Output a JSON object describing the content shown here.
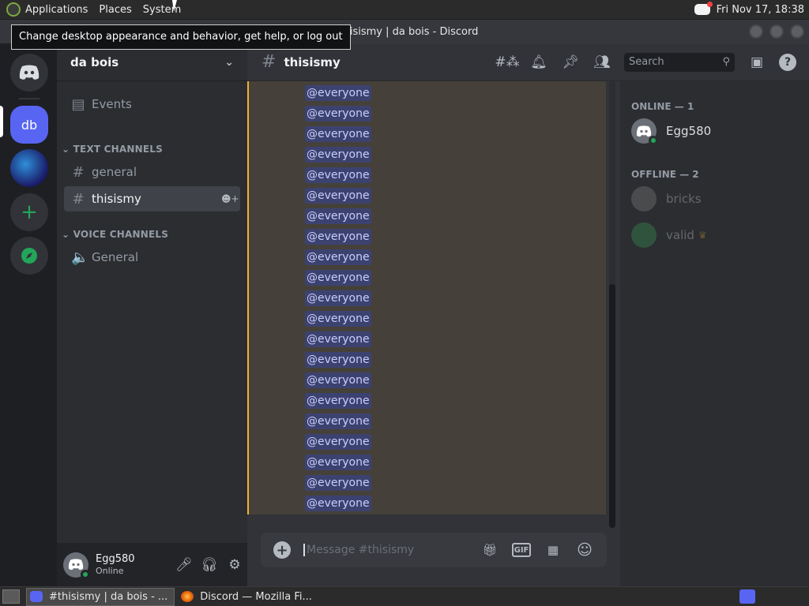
{
  "desktop": {
    "menus": [
      "Applications",
      "Places",
      "System"
    ],
    "clock": "Fri Nov 17, 18:38",
    "tooltip": "Change desktop appearance and behavior, get help, or log out"
  },
  "window": {
    "title": "#thisismy | da bois - Discord"
  },
  "guilds": {
    "db_label": "db"
  },
  "server": {
    "name": "da bois",
    "events_label": "Events",
    "text_category": "TEXT CHANNELS",
    "text_channels": [
      {
        "name": "general"
      },
      {
        "name": "thisismy"
      }
    ],
    "voice_category": "VOICE CHANNELS",
    "voice_channels": [
      {
        "name": "General"
      }
    ]
  },
  "user": {
    "name": "Egg580",
    "status": "Online"
  },
  "channel": {
    "name": "thisismy",
    "search_placeholder": "Search",
    "message_placeholder": "Message #thisismy",
    "gif_label": "GIF"
  },
  "messages": {
    "mention_text": "@everyone",
    "mention_count": 21
  },
  "members": {
    "online_header": "ONLINE — 1",
    "online": [
      {
        "name": "Egg580"
      }
    ],
    "offline_header": "OFFLINE — 2",
    "offline": [
      {
        "name": "bricks"
      },
      {
        "name": "valid"
      }
    ]
  },
  "taskbar": {
    "items": [
      "#thisismy | da bois - ...",
      "Discord — Mozilla Fi..."
    ]
  },
  "colors": {
    "accent": "#5865f2",
    "online": "#23a55a",
    "mention_highlight": "#f0b232"
  }
}
